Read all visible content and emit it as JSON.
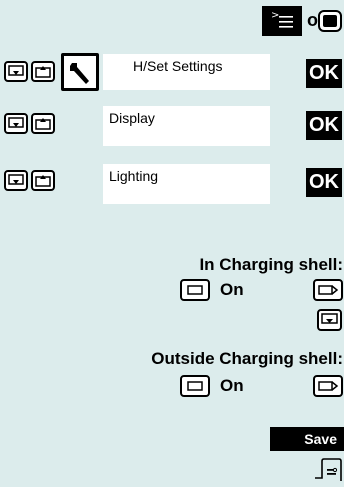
{
  "top": {
    "or_label": "or"
  },
  "menu_rows": [
    {
      "label": "H/Set Settings",
      "ok": "OK"
    },
    {
      "label": "Display",
      "ok": "OK"
    },
    {
      "label": "Lighting",
      "ok": "OK"
    }
  ],
  "charging": {
    "in_heading": "In Charging shell:",
    "in_value": "On",
    "out_heading": "Outside Charging shell:",
    "out_value": "On"
  },
  "save_label": "Save",
  "icons": [
    "menu-key-icon",
    "display-key-icon",
    "nav-down-key-icon",
    "nav-up-key-icon",
    "settings-wrench-icon",
    "left-select-key-icon",
    "right-select-key-icon",
    "end-call-key-icon"
  ],
  "colors": {
    "background": "#dcecec",
    "box": "#ffffff",
    "ok_bg": "#000000",
    "ok_text": "#ffffff"
  }
}
